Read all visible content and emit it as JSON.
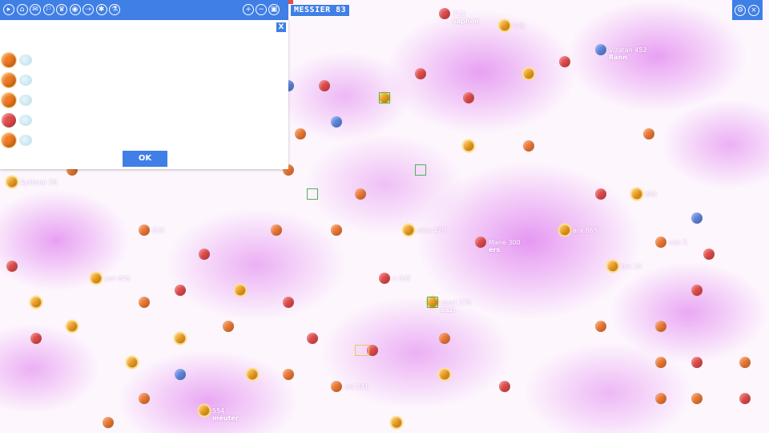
{
  "toolbar": {
    "left_icons": [
      "play-icon",
      "home-icon",
      "mail-icon",
      "fleet-icon",
      "alliance-icon",
      "globe-icon",
      "ship-icon",
      "star-icon",
      "research-icon"
    ],
    "right_icons": [
      "zoom-in-icon",
      "zoom-out-icon",
      "fullscreen-icon"
    ],
    "sector_name": "MESSIER 83"
  },
  "corner_controls": {
    "icons": [
      "settings-icon",
      "close-icon"
    ]
  },
  "dialog": {
    "close_label": "X",
    "ok_label": "OK",
    "rows": [
      {
        "planet_color": "orange",
        "icon": "cloud-icon"
      },
      {
        "planet_color": "orange",
        "icon": "cloud-icon"
      },
      {
        "planet_color": "orange",
        "icon": "cloud-icon"
      },
      {
        "planet_color": "red",
        "icon": "cloud-icon"
      },
      {
        "planet_color": "orange",
        "icon": "cloud-icon"
      }
    ]
  },
  "map": {
    "colors": {
      "accent": "#3f7fe6",
      "nebula": "#d65aea",
      "orange": "#ee7a35",
      "red": "#e34c4c",
      "blue": "#5f87e2",
      "owned": "#f0a020"
    },
    "planets": [
      {
        "type": "red",
        "label": "713",
        "owner": "saphon"
      },
      {
        "type": "owned",
        "label": "895",
        "owner": ""
      },
      {
        "type": "blue",
        "label": "Vizatan 452",
        "owner": "Rann"
      },
      {
        "type": "red",
        "label": "",
        "owner": ""
      },
      {
        "type": "owned",
        "label": "",
        "owner": ""
      },
      {
        "type": "red",
        "label": "",
        "owner": ""
      },
      {
        "type": "red",
        "label": "",
        "owner": ""
      },
      {
        "type": "owned",
        "label": "",
        "owner": ""
      },
      {
        "type": "red",
        "label": "",
        "owner": ""
      },
      {
        "type": "blue",
        "label": "",
        "owner": ""
      },
      {
        "type": "orange",
        "label": "",
        "owner": ""
      },
      {
        "type": "blue",
        "label": "",
        "owner": ""
      },
      {
        "type": "owned",
        "label": "",
        "owner": ""
      },
      {
        "type": "orange",
        "label": "",
        "owner": ""
      },
      {
        "type": "orange",
        "label": "",
        "owner": ""
      },
      {
        "type": "owned",
        "label": "Ayatmar 58",
        "owner": ""
      },
      {
        "type": "orange",
        "label": "",
        "owner": ""
      },
      {
        "type": "red",
        "label": "",
        "owner": ""
      },
      {
        "type": "owned",
        "label": "885",
        "owner": ""
      },
      {
        "type": "blue",
        "label": "",
        "owner": ""
      },
      {
        "type": "orange",
        "label": "626",
        "owner": ""
      },
      {
        "type": "orange",
        "label": "",
        "owner": ""
      },
      {
        "type": "orange",
        "label": "",
        "owner": ""
      },
      {
        "type": "owned",
        "label": "ellus 478",
        "owner": ""
      },
      {
        "type": "red",
        "label": "Mane 300",
        "owner": "ers"
      },
      {
        "type": "owned",
        "label": "ara 865",
        "owner": ""
      },
      {
        "type": "orange",
        "label": "nah 5",
        "owner": ""
      },
      {
        "type": "red",
        "label": "",
        "owner": ""
      },
      {
        "type": "red",
        "label": "",
        "owner": ""
      },
      {
        "type": "red",
        "label": "",
        "owner": ""
      },
      {
        "type": "owned",
        "label": "tan 24",
        "owner": ""
      },
      {
        "type": "owned",
        "label": "yon 645",
        "owner": ""
      },
      {
        "type": "red",
        "label": "",
        "owner": ""
      },
      {
        "type": "owned",
        "label": "",
        "owner": ""
      },
      {
        "type": "red",
        "label": "n 632",
        "owner": ""
      },
      {
        "type": "red",
        "label": "",
        "owner": ""
      },
      {
        "type": "owned",
        "label": "",
        "owner": ""
      },
      {
        "type": "orange",
        "label": "",
        "owner": ""
      },
      {
        "type": "red",
        "label": "",
        "owner": ""
      },
      {
        "type": "owned",
        "label": "zaurl 179",
        "owner": "oazi"
      },
      {
        "type": "owned",
        "label": "",
        "owner": ""
      },
      {
        "type": "orange",
        "label": "",
        "owner": ""
      },
      {
        "type": "orange",
        "label": "",
        "owner": ""
      },
      {
        "type": "red",
        "label": "",
        "owner": ""
      },
      {
        "type": "owned",
        "label": "",
        "owner": ""
      },
      {
        "type": "red",
        "label": "",
        "owner": ""
      },
      {
        "type": "red",
        "label": "",
        "owner": ""
      },
      {
        "type": "orange",
        "label": "",
        "owner": ""
      },
      {
        "type": "orange",
        "label": "",
        "owner": ""
      },
      {
        "type": "owned",
        "label": "",
        "owner": ""
      },
      {
        "type": "blue",
        "label": "",
        "owner": ""
      },
      {
        "type": "owned",
        "label": "",
        "owner": ""
      },
      {
        "type": "orange",
        "label": "",
        "owner": ""
      },
      {
        "type": "owned",
        "label": "",
        "owner": ""
      },
      {
        "type": "orange",
        "label": "",
        "owner": ""
      },
      {
        "type": "orange",
        "label": "old 841",
        "owner": ""
      },
      {
        "type": "red",
        "label": "",
        "owner": ""
      },
      {
        "type": "orange",
        "label": "",
        "owner": ""
      },
      {
        "type": "red",
        "label": "",
        "owner": ""
      },
      {
        "type": "red",
        "label": "",
        "owner": ""
      },
      {
        "type": "orange",
        "label": "",
        "owner": ""
      },
      {
        "type": "owned",
        "label": "554",
        "owner": "meuter"
      },
      {
        "type": "orange",
        "label": "",
        "owner": ""
      },
      {
        "type": "owned",
        "label": "",
        "owner": ""
      },
      {
        "type": "orange",
        "label": "",
        "owner": ""
      },
      {
        "type": "orange",
        "label": "",
        "owner": ""
      },
      {
        "type": "orange",
        "label": "",
        "owner": ""
      },
      {
        "type": "orange",
        "label": "",
        "owner": ""
      },
      {
        "type": "orange",
        "label": "",
        "owner": ""
      },
      {
        "type": "orange",
        "label": "",
        "owner": ""
      },
      {
        "type": "orange",
        "label": "",
        "owner": ""
      }
    ]
  }
}
